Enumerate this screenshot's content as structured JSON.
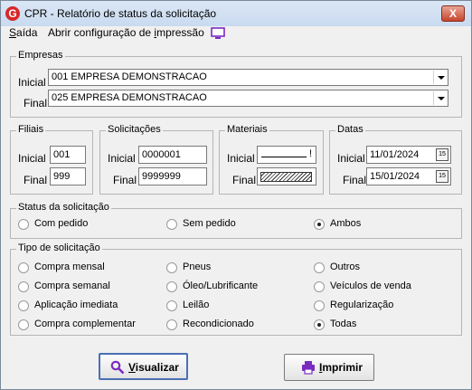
{
  "window": {
    "title": "CPR - Relatório de status da solicitação",
    "close_label": "X",
    "app_icon_letter": "G"
  },
  "menu": {
    "saida_u": "S",
    "saida_rest": "aída",
    "abrir_pre": "Abrir configuração de ",
    "abrir_u": "i",
    "abrir_post": "mpressão"
  },
  "empresas": {
    "legend": "Empresas",
    "inicial_label": "Inicial",
    "inicial_value": "001 EMPRESA DEMONSTRACAO",
    "final_label": "Final",
    "final_value": "025 EMPRESA DEMONSTRACAO"
  },
  "filiais": {
    "legend": "Filiais",
    "inicial_label": "Inicial",
    "inicial_value": "001",
    "final_label": "Final",
    "final_value": "999"
  },
  "solicitacoes": {
    "legend": "Solicitações",
    "inicial_label": "Inicial",
    "inicial_value": "0000001",
    "final_label": "Final",
    "final_value": "9999999"
  },
  "materiais": {
    "legend": "Materiais",
    "inicial_label": "Inicial",
    "inicial_value": "!",
    "final_label": "Final"
  },
  "datas": {
    "legend": "Datas",
    "inicial_label": "Inicial",
    "inicial_value": "11/01/2024",
    "final_label": "Final",
    "final_value": "15/01/2024",
    "cal_icon_text": "15"
  },
  "status": {
    "legend": "Status da solicitação",
    "options": [
      "Com pedido",
      "Sem pedido",
      "Ambos"
    ],
    "selected": "Ambos"
  },
  "tipo": {
    "legend": "Tipo de solicitação",
    "col1": [
      "Compra mensal",
      "Compra semanal",
      "Aplicação imediata",
      "Compra complementar"
    ],
    "col2": [
      "Pneus",
      "Óleo/Lubrificante",
      "Leilão",
      "Recondicionado"
    ],
    "col3": [
      "Outros",
      "Veículos de venda",
      "Regularização",
      "Todas"
    ],
    "selected": "Todas"
  },
  "buttons": {
    "visualizar_u": "V",
    "visualizar_rest": "isualizar",
    "imprimir_u": "I",
    "imprimir_rest": "mprimir"
  }
}
